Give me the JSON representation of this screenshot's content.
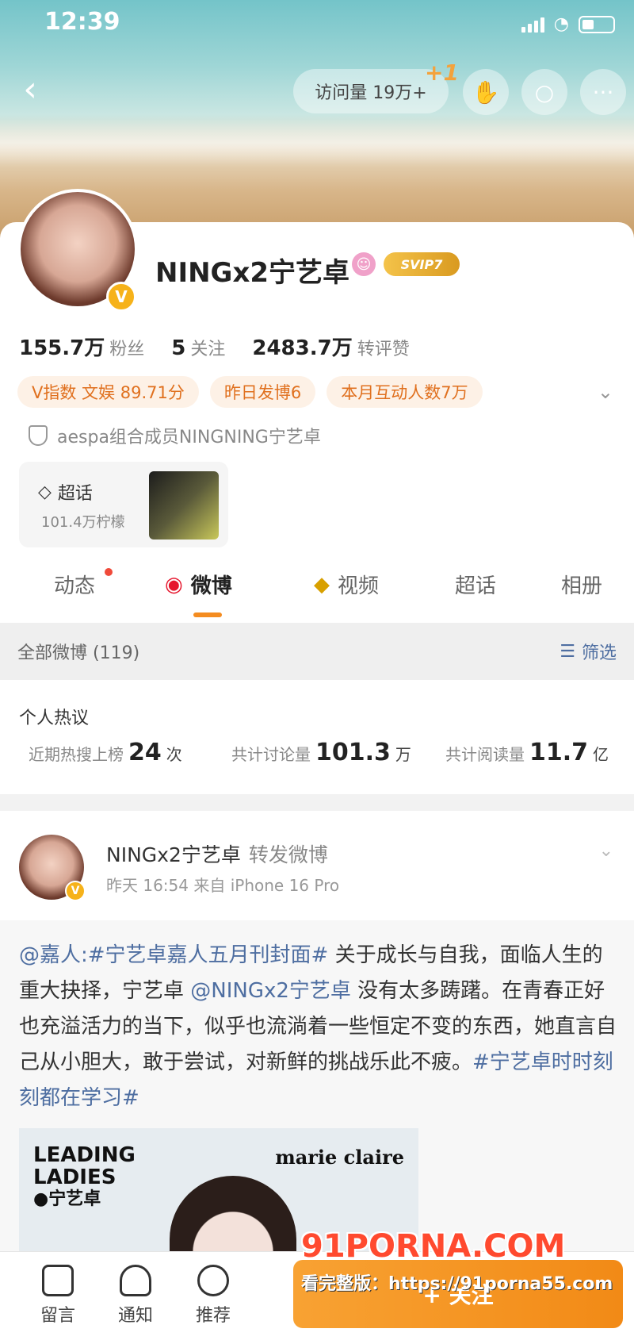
{
  "status_bar": {
    "time": "12:39"
  },
  "topbar": {
    "visits": "访问量 19万+",
    "visits_plus": "+1",
    "more": "···"
  },
  "profile": {
    "name": "NINGx2宁艺卓",
    "svip": "SVIP7",
    "stats": [
      {
        "value": "155.7万",
        "label": "粉丝"
      },
      {
        "value": "5",
        "label": "关注"
      },
      {
        "value": "2483.7万",
        "label": "转评赞"
      }
    ],
    "tags": [
      "V指数 文娱 89.71分",
      "昨日发博6",
      "本月互动人数7万"
    ],
    "verification": "aespa组合成员NINGNING宁艺卓",
    "chaohua": {
      "title": "超话",
      "sub": "101.4万柠檬"
    }
  },
  "tabs": [
    {
      "label": "动态"
    },
    {
      "label": "微博"
    },
    {
      "label": "视频"
    },
    {
      "label": "超话"
    },
    {
      "label": "相册"
    }
  ],
  "filter_bar": {
    "left": "全部微博 (119)",
    "right": "筛选"
  },
  "hot_discussion": {
    "title": "个人热议",
    "items": [
      {
        "label": "近期热搜上榜",
        "value": "24",
        "unit": "次"
      },
      {
        "label": "共计讨论量",
        "value": "101.3",
        "unit": "万"
      },
      {
        "label": "共计阅读量",
        "value": "11.7",
        "unit": "亿"
      }
    ]
  },
  "post": {
    "author": "NINGx2宁艺卓",
    "action": "转发微博",
    "meta": "昨天 16:54  来自 iPhone 16 Pro",
    "repost_mention": "@嘉人:",
    "repost_tag1": "#宁艺卓嘉人五月刊封面#",
    "repost_text1": " 关于成长与自我，面临人生的重大抉择，宁艺卓 ",
    "repost_mention2": "@NINGx2宁艺卓",
    "repost_text2": " 没有太多踌躇。在青春正好也充溢活力的当下，似乎也流淌着一些恒定不变的东西，她直言自己从小胆大，敢于尝试，对新鲜的挑战乐此不疲。",
    "repost_tag2": "#宁艺卓时时刻刻都在学习#",
    "poster_title": "LEADING LADIES",
    "poster_name": "●宁艺卓",
    "poster_brand": "marie claire"
  },
  "bottom_bar": {
    "items": [
      "留言",
      "通知",
      "推荐"
    ],
    "follow": "+ 关注"
  },
  "watermark": {
    "line1": "91PORNA.COM",
    "line2": "看完整版：https://91porna55.com"
  }
}
